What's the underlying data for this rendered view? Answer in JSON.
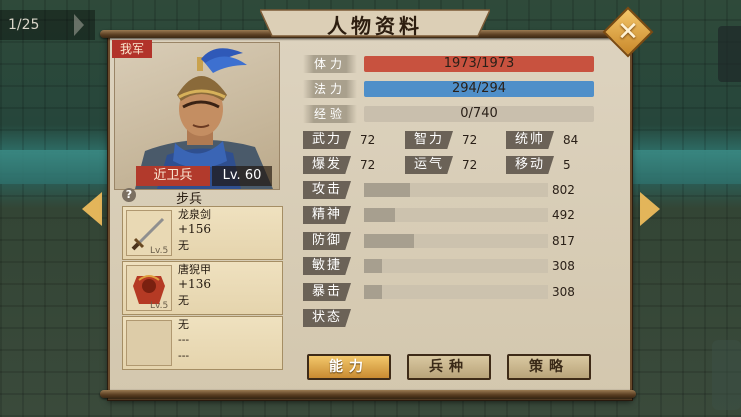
{
  "counter": "1/25",
  "title": "人物资料",
  "portrait": {
    "faction": "我军",
    "unit_name": "近卫兵",
    "level": "Lv. 60"
  },
  "troop_type": "步兵",
  "help_symbol": "?",
  "equipment": [
    {
      "icon": "sword-icon",
      "lv": "Lv.5",
      "name": "龙泉剑",
      "bonus": "+156",
      "extra": "无"
    },
    {
      "icon": "armor-icon",
      "lv": "Lv.5",
      "name": "唐猊甲",
      "bonus": "+136",
      "extra": "无"
    },
    {
      "icon": "empty-slot-icon",
      "lv": "",
      "name": "无",
      "bonus": "---",
      "extra": "---"
    }
  ],
  "bars": {
    "hp": {
      "label": "体力",
      "value": "1973/1973",
      "fill": 1.0,
      "color": "#c8523f"
    },
    "mp": {
      "label": "法力",
      "value": "294/294",
      "fill": 1.0,
      "color": "#4f8fc9"
    },
    "exp": {
      "label": "经验",
      "value": "0/740",
      "fill": 0.0,
      "color": "#c9bfad"
    }
  },
  "attributes": [
    {
      "label": "武力",
      "value": "72"
    },
    {
      "label": "智力",
      "value": "72"
    },
    {
      "label": "统帅",
      "value": "84"
    },
    {
      "label": "爆发",
      "value": "72"
    },
    {
      "label": "运气",
      "value": "72"
    },
    {
      "label": "移动",
      "value": "5"
    }
  ],
  "combat_stats": [
    {
      "label": "攻击",
      "value": "802",
      "fill": 0.25
    },
    {
      "label": "精神",
      "value": "492",
      "fill": 0.17
    },
    {
      "label": "防御",
      "value": "817",
      "fill": 0.27
    },
    {
      "label": "敏捷",
      "value": "308",
      "fill": 0.1
    },
    {
      "label": "暴击",
      "value": "308",
      "fill": 0.1
    },
    {
      "label": "状态",
      "value": "",
      "fill": null
    }
  ],
  "tabs": [
    {
      "label": "能力",
      "active": true
    },
    {
      "label": "兵种",
      "active": false
    },
    {
      "label": "策略",
      "active": false
    }
  ],
  "colors": {
    "accent_gold": "#e0a848",
    "faction_red": "#b2332a"
  }
}
